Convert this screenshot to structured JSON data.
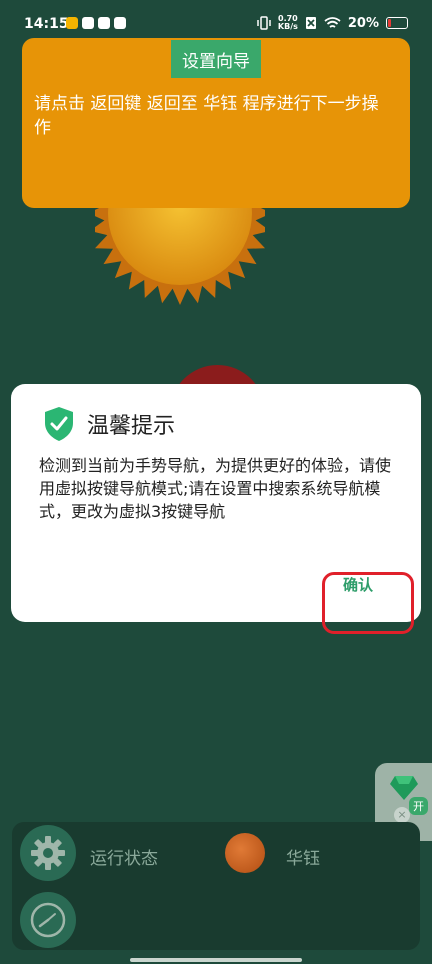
{
  "status_bar": {
    "time": "14:15",
    "net_speed_value": "0.70",
    "net_speed_unit": "KB/s",
    "battery_text": "20%",
    "battery_level": 0.2
  },
  "guide": {
    "title": "设置向导",
    "instruction": "请点击 返回键 返回至 华钰 程序进行下一步操作"
  },
  "dialog": {
    "title": "温馨提示",
    "body": "检测到当前为手势导航，为提供更好的体验，请使用虚拟按键导航模式;请在设置中搜索系统导航模式，更改为虚拟3按键导航",
    "confirm_label": "确认"
  },
  "bottom_panel": {
    "status_label": "运行状态",
    "app_label": "华钰"
  },
  "float_widget": {
    "badge": "开"
  },
  "colors": {
    "background": "#1e4a3b",
    "guide_panel": "#e79407",
    "accent_green": "#3aa86b",
    "highlight_red": "#e0202a"
  }
}
